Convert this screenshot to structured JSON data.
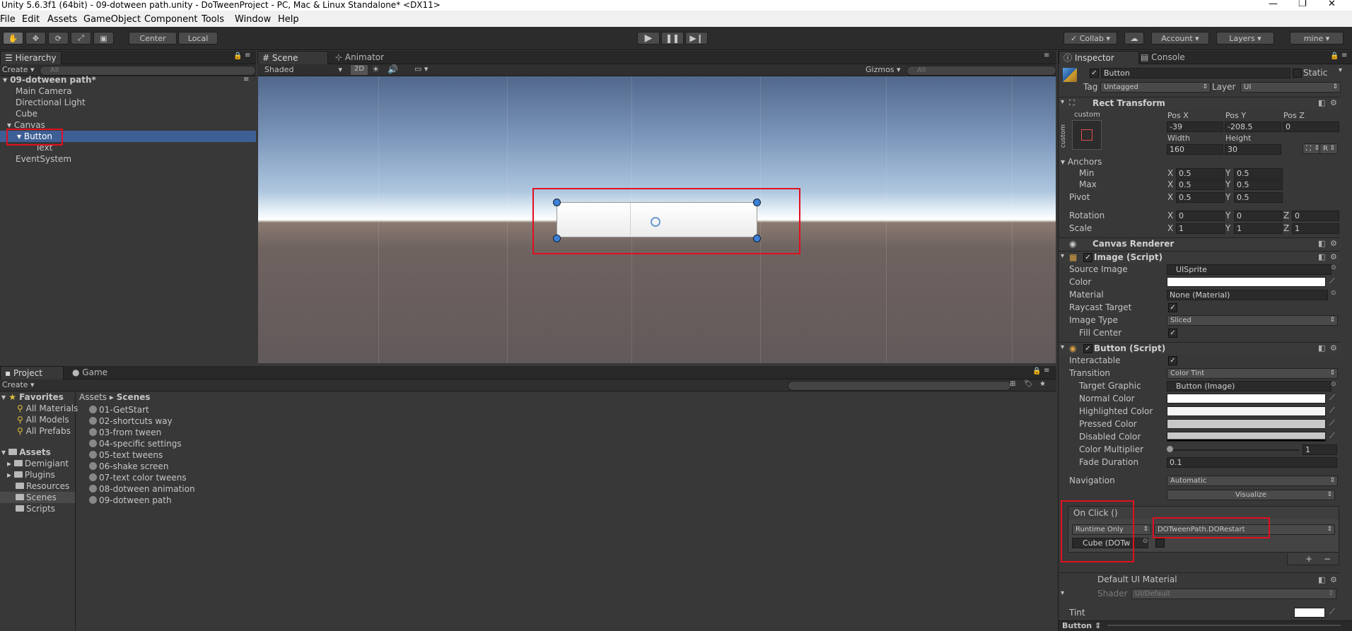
{
  "window": {
    "title": "Unity 5.6.3f1 (64bit) - 09-dotween path.unity - DoTweenProject - PC, Mac & Linux Standalone* <DX11>"
  },
  "menu": [
    "File",
    "Edit",
    "Assets",
    "GameObject",
    "Component",
    "Tools",
    "Window",
    "Help"
  ],
  "toolbar": {
    "pivot_center": "Center",
    "pivot_local": "Local",
    "collab": "Collab",
    "account": "Account",
    "layers": "Layers",
    "layout": "mine"
  },
  "hierarchy": {
    "tab": "Hierarchy",
    "create": "Create",
    "search_placeholder": "All",
    "scene_name": "09-dotween path*",
    "items": [
      "Main Camera",
      "Directional Light",
      "Cube",
      "Canvas",
      "Button",
      "Text",
      "EventSystem"
    ]
  },
  "scene": {
    "tab_scene": "Scene",
    "tab_animator": "Animator",
    "shading": "Shaded",
    "mode_2d": "2D",
    "gizmos": "Gizmos",
    "search_placeholder": "All"
  },
  "project": {
    "tab_project": "Project",
    "tab_game": "Game",
    "create": "Create",
    "favorites_label": "Favorites",
    "favorites": [
      "All Materials",
      "All Models",
      "All Prefabs"
    ],
    "assets_label": "Assets",
    "asset_folders": [
      "Demigiant",
      "Plugins",
      "Resources",
      "Scenes",
      "Scripts"
    ],
    "breadcrumb_root": "Assets",
    "breadcrumb_sep": "▸",
    "breadcrumb_current": "Scenes",
    "scenes": [
      "01-GetStart",
      "02-shortcuts way",
      "03-from tween",
      "04-specific settings",
      "05-text tweens",
      "06-shake screen",
      "07-text color tweens",
      "08-dotween animation",
      "09-dotween path"
    ]
  },
  "inspector": {
    "tab_inspector": "Inspector",
    "tab_console": "Console",
    "object_name": "Button",
    "static_label": "Static",
    "tag_label": "Tag",
    "tag_value": "Untagged",
    "layer_label": "Layer",
    "layer_value": "UI",
    "rect_transform": {
      "title": "Rect Transform",
      "anchor_preset": "custom",
      "posx_label": "Pos X",
      "posy_label": "Pos Y",
      "posz_label": "Pos Z",
      "posx": "-39",
      "posy": "-208.5",
      "posz": "0",
      "width_label": "Width",
      "height_label": "Height",
      "width": "160",
      "height": "30",
      "r_button": "R",
      "anchors_label": "Anchors",
      "min_label": "Min",
      "max_label": "Max",
      "pivot_label": "Pivot",
      "x_label": "X",
      "y_label": "Y",
      "z_label": "Z",
      "min_x": "0.5",
      "min_y": "0.5",
      "max_x": "0.5",
      "max_y": "0.5",
      "pivot_x": "0.5",
      "pivot_y": "0.5",
      "rotation_label": "Rotation",
      "rot_x": "0",
      "rot_y": "0",
      "rot_z": "0",
      "scale_label": "Scale",
      "scale_x": "1",
      "scale_y": "1",
      "scale_z": "1"
    },
    "canvas_renderer": {
      "title": "Canvas Renderer"
    },
    "image": {
      "title": "Image (Script)",
      "source_image_label": "Source Image",
      "source_image": "UISprite",
      "color_label": "Color",
      "material_label": "Material",
      "material": "None (Material)",
      "raycast_label": "Raycast Target",
      "image_type_label": "Image Type",
      "image_type": "Sliced",
      "fill_center_label": "Fill Center"
    },
    "button": {
      "title": "Button (Script)",
      "interactable_label": "Interactable",
      "transition_label": "Transition",
      "transition": "Color Tint",
      "target_graphic_label": "Target Graphic",
      "target_graphic": "Button (Image)",
      "normal_color_label": "Normal Color",
      "highlighted_color_label": "Highlighted Color",
      "pressed_color_label": "Pressed Color",
      "disabled_color_label": "Disabled Color",
      "color_multiplier_label": "Color Multiplier",
      "color_multiplier": "1",
      "fade_duration_label": "Fade Duration",
      "fade_duration": "0.1",
      "navigation_label": "Navigation",
      "navigation": "Automatic",
      "visualize": "Visualize",
      "onclick_label": "On Click ()",
      "runtime": "Runtime Only",
      "function": "DOTweenPath.DORestart",
      "object": "Cube (DOTw",
      "plus": "+",
      "minus": "−"
    },
    "material": {
      "title": "Default UI Material",
      "shader_label": "Shader",
      "shader": "UI/Default",
      "tint_label": "Tint"
    },
    "footer": "Button"
  },
  "colors": {
    "selection": "#3e5f96",
    "highlight_red": "#e01020",
    "panel": "#383838"
  }
}
